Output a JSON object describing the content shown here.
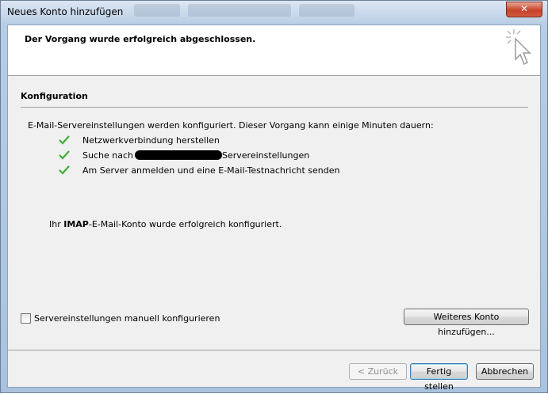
{
  "window": {
    "title": "Neues Konto hinzufügen",
    "close_label": "✕"
  },
  "header": {
    "title": "Der Vorgang wurde erfolgreich abgeschlossen.",
    "icon": "cursor-icon"
  },
  "config": {
    "section_title": "Konfiguration",
    "description": "E-Mail-Servereinstellungen werden konfiguriert. Dieser Vorgang kann einige Minuten dauern:",
    "steps": [
      {
        "label": "Netzwerkverbindung herstellen",
        "status": "done"
      },
      {
        "label_prefix": "Suche nach ",
        "label_suffix": "Servereinstellungen",
        "status": "done"
      },
      {
        "label": "Am Server anmelden und eine E-Mail-Testnachricht senden",
        "status": "done"
      }
    ],
    "success_prefix": "Ihr ",
    "success_bold": "IMAP",
    "success_suffix": "-E-Mail-Konto wurde erfolgreich konfiguriert."
  },
  "options": {
    "manual_config_label": "Servereinstellungen manuell konfigurieren",
    "manual_config_checked": false
  },
  "buttons": {
    "add_account": "Weiteres Konto hinzufügen...",
    "back": "< Zurück",
    "finish": "Fertig stellen",
    "cancel": "Abbrechen"
  },
  "colors": {
    "check": "#3fae3a"
  }
}
